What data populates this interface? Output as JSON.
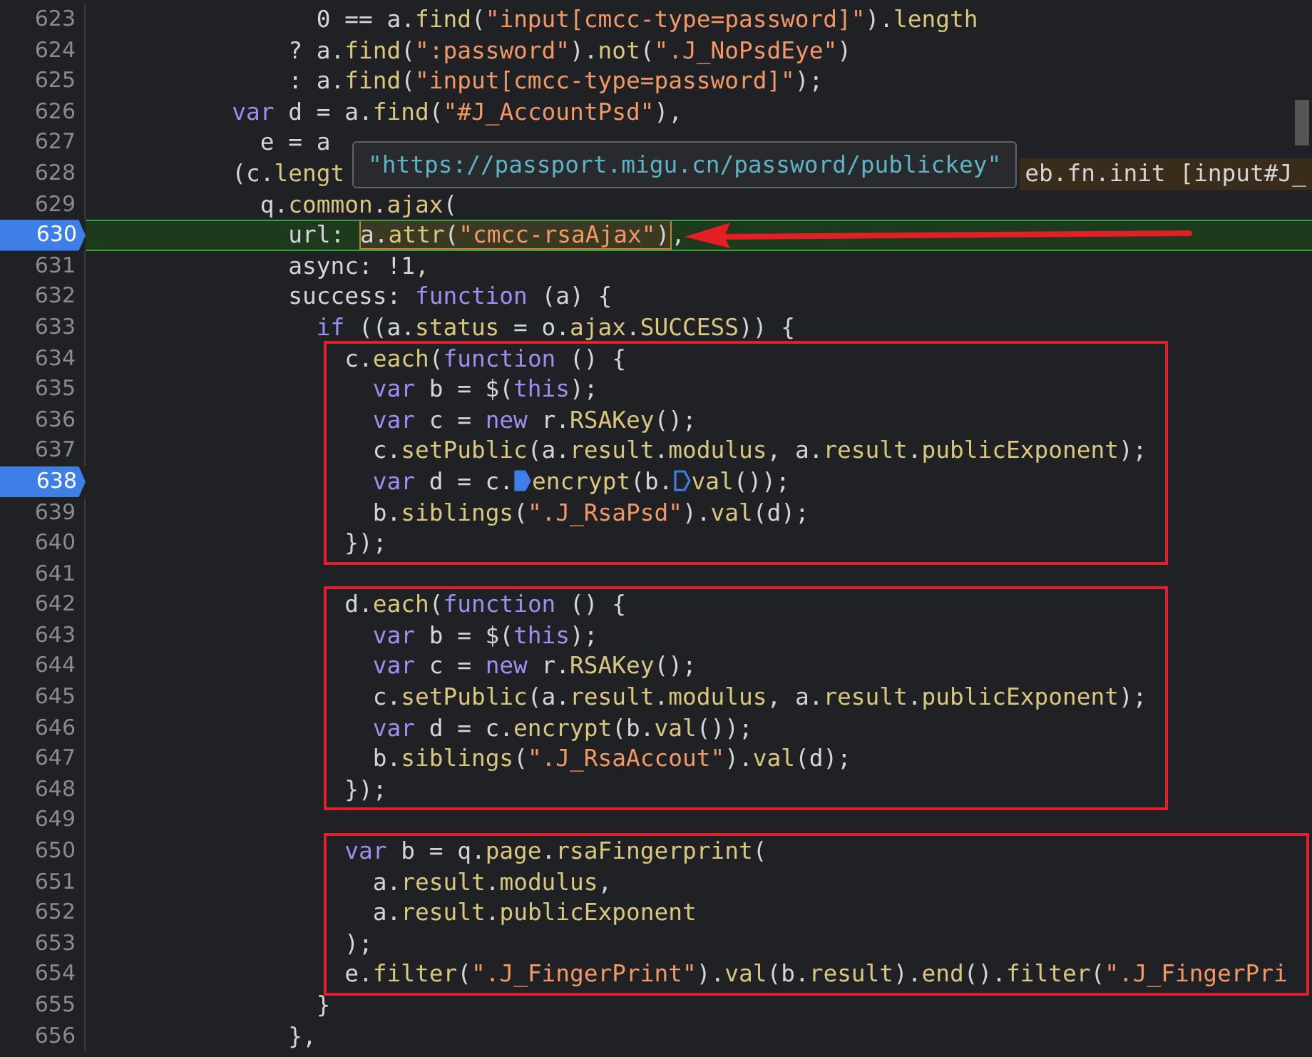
{
  "tooltip": {
    "text": "\"https://passport.migu.cn/password/publickey\""
  },
  "sections": [
    {
      "boxed": false,
      "lines": [
        {
          "number": "623",
          "breakpoint": false,
          "current": false,
          "segments": [
            {
              "text": "                0 == a.",
              "kind": "plain"
            },
            {
              "text": "find",
              "kind": "prop"
            },
            {
              "text": "(",
              "kind": "plain"
            },
            {
              "text": "\"input[cmcc-type=password]\"",
              "kind": "string"
            },
            {
              "text": ").",
              "kind": "plain"
            },
            {
              "text": "length",
              "kind": "prop"
            }
          ]
        },
        {
          "number": "624",
          "breakpoint": false,
          "current": false,
          "segments": [
            {
              "text": "              ? a.",
              "kind": "plain"
            },
            {
              "text": "find",
              "kind": "prop"
            },
            {
              "text": "(",
              "kind": "plain"
            },
            {
              "text": "\":password\"",
              "kind": "string"
            },
            {
              "text": ").",
              "kind": "plain"
            },
            {
              "text": "not",
              "kind": "prop"
            },
            {
              "text": "(",
              "kind": "plain"
            },
            {
              "text": "\".J_NoPsdEye\"",
              "kind": "string"
            },
            {
              "text": ")",
              "kind": "plain"
            }
          ]
        },
        {
          "number": "625",
          "breakpoint": false,
          "current": false,
          "segments": [
            {
              "text": "              : a.",
              "kind": "plain"
            },
            {
              "text": "find",
              "kind": "prop"
            },
            {
              "text": "(",
              "kind": "plain"
            },
            {
              "text": "\"input[cmcc-type=password]\"",
              "kind": "string"
            },
            {
              "text": ");",
              "kind": "plain"
            }
          ]
        },
        {
          "number": "626",
          "breakpoint": false,
          "current": false,
          "segments": [
            {
              "text": "          var",
              "kind": "keyword"
            },
            {
              "text": " d = a.",
              "kind": "plain"
            },
            {
              "text": "find",
              "kind": "prop"
            },
            {
              "text": "(",
              "kind": "plain"
            },
            {
              "text": "\"#J_AccountPsd\"",
              "kind": "string"
            },
            {
              "text": "),",
              "kind": "plain"
            }
          ]
        },
        {
          "number": "627",
          "breakpoint": false,
          "current": false,
          "segments": [
            {
              "text": "            e = a",
              "kind": "plain"
            }
          ]
        },
        {
          "number": "628",
          "breakpoint": false,
          "current": false,
          "inline_value": "eb.fn.init [input#J_",
          "segments": [
            {
              "text": "          (c.",
              "kind": "plain"
            },
            {
              "text": "lengt",
              "kind": "prop"
            }
          ]
        },
        {
          "number": "629",
          "breakpoint": false,
          "current": false,
          "segments": [
            {
              "text": "            q.",
              "kind": "plain"
            },
            {
              "text": "common",
              "kind": "prop"
            },
            {
              "text": ".",
              "kind": "plain"
            },
            {
              "text": "ajax",
              "kind": "prop"
            },
            {
              "text": "(",
              "kind": "plain"
            }
          ]
        },
        {
          "number": "630",
          "breakpoint": true,
          "current": true,
          "pointer_arrow": true,
          "segments": [
            {
              "text": "              url: ",
              "kind": "plain"
            },
            {
              "kind": "hover",
              "parts": [
                {
                  "text": "a.",
                  "kind": "plain"
                },
                {
                  "text": "attr",
                  "kind": "prop"
                },
                {
                  "text": "(",
                  "kind": "plain"
                },
                {
                  "text": "\"cmcc-rsaAjax\"",
                  "kind": "string"
                },
                {
                  "text": ")",
                  "kind": "plain"
                }
              ]
            },
            {
              "text": ",",
              "kind": "plain"
            }
          ]
        },
        {
          "number": "631",
          "breakpoint": false,
          "current": false,
          "segments": [
            {
              "text": "              async: !1,",
              "kind": "plain"
            }
          ]
        },
        {
          "number": "632",
          "breakpoint": false,
          "current": false,
          "segments": [
            {
              "text": "              success: ",
              "kind": "plain"
            },
            {
              "text": "function",
              "kind": "keyword"
            },
            {
              "text": " (a) {",
              "kind": "plain"
            }
          ]
        },
        {
          "number": "633",
          "breakpoint": false,
          "current": false,
          "segments": [
            {
              "text": "                if",
              "kind": "keyword"
            },
            {
              "text": " ((a.",
              "kind": "plain"
            },
            {
              "text": "status",
              "kind": "prop"
            },
            {
              "text": " = o.",
              "kind": "plain"
            },
            {
              "text": "ajax",
              "kind": "prop"
            },
            {
              "text": ".",
              "kind": "plain"
            },
            {
              "text": "SUCCESS",
              "kind": "prop"
            },
            {
              "text": ")) {",
              "kind": "plain"
            }
          ]
        }
      ]
    },
    {
      "boxed": true,
      "lines": [
        {
          "number": "634",
          "breakpoint": false,
          "current": false,
          "segments": [
            {
              "text": "                  c.",
              "kind": "plain"
            },
            {
              "text": "each",
              "kind": "prop"
            },
            {
              "text": "(",
              "kind": "plain"
            },
            {
              "text": "function",
              "kind": "keyword"
            },
            {
              "text": " () {",
              "kind": "plain"
            }
          ]
        },
        {
          "number": "635",
          "breakpoint": false,
          "current": false,
          "segments": [
            {
              "text": "                    var",
              "kind": "keyword"
            },
            {
              "text": " b = $(",
              "kind": "plain"
            },
            {
              "text": "this",
              "kind": "keyword"
            },
            {
              "text": ");",
              "kind": "plain"
            }
          ]
        },
        {
          "number": "636",
          "breakpoint": false,
          "current": false,
          "segments": [
            {
              "text": "                    var",
              "kind": "keyword"
            },
            {
              "text": " c = ",
              "kind": "plain"
            },
            {
              "text": "new",
              "kind": "keyword"
            },
            {
              "text": " r.",
              "kind": "plain"
            },
            {
              "text": "RSAKey",
              "kind": "prop"
            },
            {
              "text": "();",
              "kind": "plain"
            }
          ]
        },
        {
          "number": "637",
          "breakpoint": false,
          "current": false,
          "segments": [
            {
              "text": "                    c.",
              "kind": "plain"
            },
            {
              "text": "setPublic",
              "kind": "prop"
            },
            {
              "text": "(a.",
              "kind": "plain"
            },
            {
              "text": "result",
              "kind": "prop"
            },
            {
              "text": ".",
              "kind": "plain"
            },
            {
              "text": "modulus",
              "kind": "prop"
            },
            {
              "text": ", a.",
              "kind": "plain"
            },
            {
              "text": "result",
              "kind": "prop"
            },
            {
              "text": ".",
              "kind": "plain"
            },
            {
              "text": "publicExponent",
              "kind": "prop"
            },
            {
              "text": ");",
              "kind": "plain"
            }
          ]
        },
        {
          "number": "638",
          "breakpoint": true,
          "current": false,
          "segments": [
            {
              "text": "                    var",
              "kind": "keyword"
            },
            {
              "text": " d = c.",
              "kind": "plain"
            },
            {
              "kind": "inline-breakpoint",
              "on": true
            },
            {
              "text": "encrypt",
              "kind": "prop"
            },
            {
              "text": "(b.",
              "kind": "plain"
            },
            {
              "kind": "inline-breakpoint",
              "on": false
            },
            {
              "text": "val",
              "kind": "prop"
            },
            {
              "text": "());",
              "kind": "plain"
            }
          ]
        },
        {
          "number": "639",
          "breakpoint": false,
          "current": false,
          "segments": [
            {
              "text": "                    b.",
              "kind": "plain"
            },
            {
              "text": "siblings",
              "kind": "prop"
            },
            {
              "text": "(",
              "kind": "plain"
            },
            {
              "text": "\".J_RsaPsd\"",
              "kind": "string"
            },
            {
              "text": ").",
              "kind": "plain"
            },
            {
              "text": "val",
              "kind": "prop"
            },
            {
              "text": "(d);",
              "kind": "plain"
            }
          ]
        },
        {
          "number": "640",
          "breakpoint": false,
          "current": false,
          "segments": [
            {
              "text": "                  });",
              "kind": "plain"
            }
          ]
        }
      ]
    },
    {
      "boxed": false,
      "lines": [
        {
          "number": "641",
          "breakpoint": false,
          "current": false
        }
      ]
    },
    {
      "boxed": true,
      "lines": [
        {
          "number": "642",
          "breakpoint": false,
          "current": false,
          "segments": [
            {
              "text": "                  d.",
              "kind": "plain"
            },
            {
              "text": "each",
              "kind": "prop"
            },
            {
              "text": "(",
              "kind": "plain"
            },
            {
              "text": "function",
              "kind": "keyword"
            },
            {
              "text": " () {",
              "kind": "plain"
            }
          ]
        },
        {
          "number": "643",
          "breakpoint": false,
          "current": false,
          "segments": [
            {
              "text": "                    var",
              "kind": "keyword"
            },
            {
              "text": " b = $(",
              "kind": "plain"
            },
            {
              "text": "this",
              "kind": "keyword"
            },
            {
              "text": ");",
              "kind": "plain"
            }
          ]
        },
        {
          "number": "644",
          "breakpoint": false,
          "current": false,
          "segments": [
            {
              "text": "                    var",
              "kind": "keyword"
            },
            {
              "text": " c = ",
              "kind": "plain"
            },
            {
              "text": "new",
              "kind": "keyword"
            },
            {
              "text": " r.",
              "kind": "plain"
            },
            {
              "text": "RSAKey",
              "kind": "prop"
            },
            {
              "text": "();",
              "kind": "plain"
            }
          ]
        },
        {
          "number": "645",
          "breakpoint": false,
          "current": false,
          "segments": [
            {
              "text": "                    c.",
              "kind": "plain"
            },
            {
              "text": "setPublic",
              "kind": "prop"
            },
            {
              "text": "(a.",
              "kind": "plain"
            },
            {
              "text": "result",
              "kind": "prop"
            },
            {
              "text": ".",
              "kind": "plain"
            },
            {
              "text": "modulus",
              "kind": "prop"
            },
            {
              "text": ", a.",
              "kind": "plain"
            },
            {
              "text": "result",
              "kind": "prop"
            },
            {
              "text": ".",
              "kind": "plain"
            },
            {
              "text": "publicExponent",
              "kind": "prop"
            },
            {
              "text": ");",
              "kind": "plain"
            }
          ]
        },
        {
          "number": "646",
          "breakpoint": false,
          "current": false,
          "segments": [
            {
              "text": "                    var",
              "kind": "keyword"
            },
            {
              "text": " d = c.",
              "kind": "plain"
            },
            {
              "text": "encrypt",
              "kind": "prop"
            },
            {
              "text": "(b.",
              "kind": "plain"
            },
            {
              "text": "val",
              "kind": "prop"
            },
            {
              "text": "());",
              "kind": "plain"
            }
          ]
        },
        {
          "number": "647",
          "breakpoint": false,
          "current": false,
          "segments": [
            {
              "text": "                    b.",
              "kind": "plain"
            },
            {
              "text": "siblings",
              "kind": "prop"
            },
            {
              "text": "(",
              "kind": "plain"
            },
            {
              "text": "\".J_RsaAccout\"",
              "kind": "string"
            },
            {
              "text": ").",
              "kind": "plain"
            },
            {
              "text": "val",
              "kind": "prop"
            },
            {
              "text": "(d);",
              "kind": "plain"
            }
          ]
        },
        {
          "number": "648",
          "breakpoint": false,
          "current": false,
          "segments": [
            {
              "text": "                  });",
              "kind": "plain"
            }
          ]
        }
      ]
    },
    {
      "boxed": false,
      "lines": [
        {
          "number": "649",
          "breakpoint": false,
          "current": false
        }
      ]
    },
    {
      "boxed": true,
      "lines": [
        {
          "number": "650",
          "breakpoint": false,
          "current": false,
          "segments": [
            {
              "text": "                  var",
              "kind": "keyword"
            },
            {
              "text": " b = q.",
              "kind": "plain"
            },
            {
              "text": "page",
              "kind": "prop"
            },
            {
              "text": ".",
              "kind": "plain"
            },
            {
              "text": "rsaFingerprint",
              "kind": "prop"
            },
            {
              "text": "(",
              "kind": "plain"
            }
          ]
        },
        {
          "number": "651",
          "breakpoint": false,
          "current": false,
          "segments": [
            {
              "text": "                    a.",
              "kind": "plain"
            },
            {
              "text": "result",
              "kind": "prop"
            },
            {
              "text": ".",
              "kind": "plain"
            },
            {
              "text": "modulus",
              "kind": "prop"
            },
            {
              "text": ",",
              "kind": "plain"
            }
          ]
        },
        {
          "number": "652",
          "breakpoint": false,
          "current": false,
          "segments": [
            {
              "text": "                    a.",
              "kind": "plain"
            },
            {
              "text": "result",
              "kind": "prop"
            },
            {
              "text": ".",
              "kind": "plain"
            },
            {
              "text": "publicExponent",
              "kind": "prop"
            }
          ]
        },
        {
          "number": "653",
          "breakpoint": false,
          "current": false,
          "segments": [
            {
              "text": "                  );",
              "kind": "plain"
            }
          ]
        },
        {
          "number": "654",
          "breakpoint": false,
          "current": false,
          "segments": [
            {
              "text": "                  e.",
              "kind": "plain"
            },
            {
              "text": "filter",
              "kind": "prop"
            },
            {
              "text": "(",
              "kind": "plain"
            },
            {
              "text": "\".J_FingerPrint\"",
              "kind": "string"
            },
            {
              "text": ").",
              "kind": "plain"
            },
            {
              "text": "val",
              "kind": "prop"
            },
            {
              "text": "(b.",
              "kind": "plain"
            },
            {
              "text": "result",
              "kind": "prop"
            },
            {
              "text": ").",
              "kind": "plain"
            },
            {
              "text": "end",
              "kind": "prop"
            },
            {
              "text": "().",
              "kind": "plain"
            },
            {
              "text": "filter",
              "kind": "prop"
            },
            {
              "text": "(",
              "kind": "plain"
            },
            {
              "text": "\".J_FingerPri",
              "kind": "string"
            }
          ]
        }
      ]
    },
    {
      "boxed": false,
      "lines": [
        {
          "number": "655",
          "breakpoint": false,
          "current": false,
          "segments": [
            {
              "text": "                }",
              "kind": "plain"
            }
          ]
        },
        {
          "number": "656",
          "breakpoint": false,
          "current": false,
          "segments": [
            {
              "text": "              },",
              "kind": "plain"
            }
          ]
        }
      ]
    }
  ]
}
